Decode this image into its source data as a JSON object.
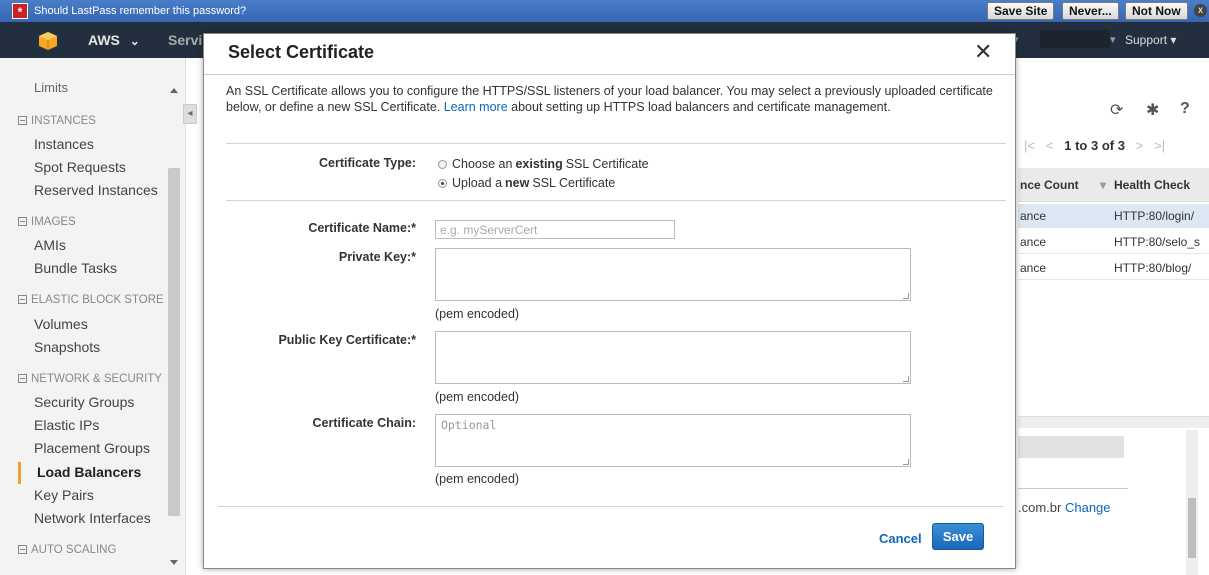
{
  "lastpass": {
    "message": "Should LastPass remember this password?",
    "icon": "*",
    "buttons": {
      "save_site": "Save Site",
      "never": "Never...",
      "not_now": "Not Now"
    },
    "close": "x"
  },
  "nav": {
    "brand": "AWS",
    "brand_chevron": "⌄",
    "services": "Servi",
    "support": "Support",
    "dropdown_glyph": "▾"
  },
  "sidebar": {
    "top_item": "Limits",
    "sections": [
      {
        "title": "INSTANCES",
        "items": [
          "Instances",
          "Spot Requests",
          "Reserved Instances"
        ]
      },
      {
        "title": "IMAGES",
        "items": [
          "AMIs",
          "Bundle Tasks"
        ]
      },
      {
        "title": "ELASTIC BLOCK STORE",
        "items": [
          "Volumes",
          "Snapshots"
        ]
      },
      {
        "title": "NETWORK & SECURITY",
        "items": [
          "Security Groups",
          "Elastic IPs",
          "Placement Groups",
          "Load Balancers",
          "Key Pairs",
          "Network Interfaces"
        ]
      },
      {
        "title": "AUTO SCALING",
        "items": []
      }
    ],
    "active_item": "Load Balancers"
  },
  "background": {
    "pager": {
      "first": "|<",
      "prev": "<",
      "range": "1 to 3 of 3",
      "next": ">",
      "last": ">|"
    },
    "columns": [
      "nce Count",
      "Health Check"
    ],
    "rows": [
      {
        "count": "ance",
        "health": "HTTP:80/login/"
      },
      {
        "count": "ance",
        "health": "HTTP:80/selo_s"
      },
      {
        "count": "ance",
        "health": "HTTP:80/blog/"
      }
    ],
    "domain": ".com.br",
    "change_link": "Change"
  },
  "modal": {
    "title": "Select Certificate",
    "close_glyph": "✕",
    "description_before": "An SSL Certificate allows you to configure the HTTPS/SSL listeners of your load balancer. You may select a previously uploaded certificate below, or define a new SSL Certificate.",
    "learn_more": "Learn more",
    "description_after": "about setting up HTTPS load balancers and certificate management.",
    "certificate_type": {
      "label": "Certificate Type:",
      "options": [
        {
          "pre": "Choose an",
          "bold": "existing",
          "post": "SSL Certificate",
          "selected": false
        },
        {
          "pre": "Upload a",
          "bold": "new",
          "post": "SSL Certificate",
          "selected": true
        }
      ]
    },
    "certificate_name": {
      "label": "Certificate Name:*",
      "placeholder": "e.g. myServerCert"
    },
    "private_key": {
      "label": "Private Key:*",
      "note": "(pem encoded)"
    },
    "public_key": {
      "label": "Public Key Certificate:*",
      "note": "(pem encoded)"
    },
    "certificate_chain": {
      "label": "Certificate Chain:",
      "placeholder": "Optional",
      "note": "(pem encoded)"
    },
    "cancel": "Cancel",
    "save": "Save"
  },
  "colors": {
    "accent": "#1166bb",
    "save_button": "#2a7ac8",
    "nav_background": "#232f3e",
    "lastpass_bar": "#3f72c0",
    "active_marker": "#f0a030"
  }
}
